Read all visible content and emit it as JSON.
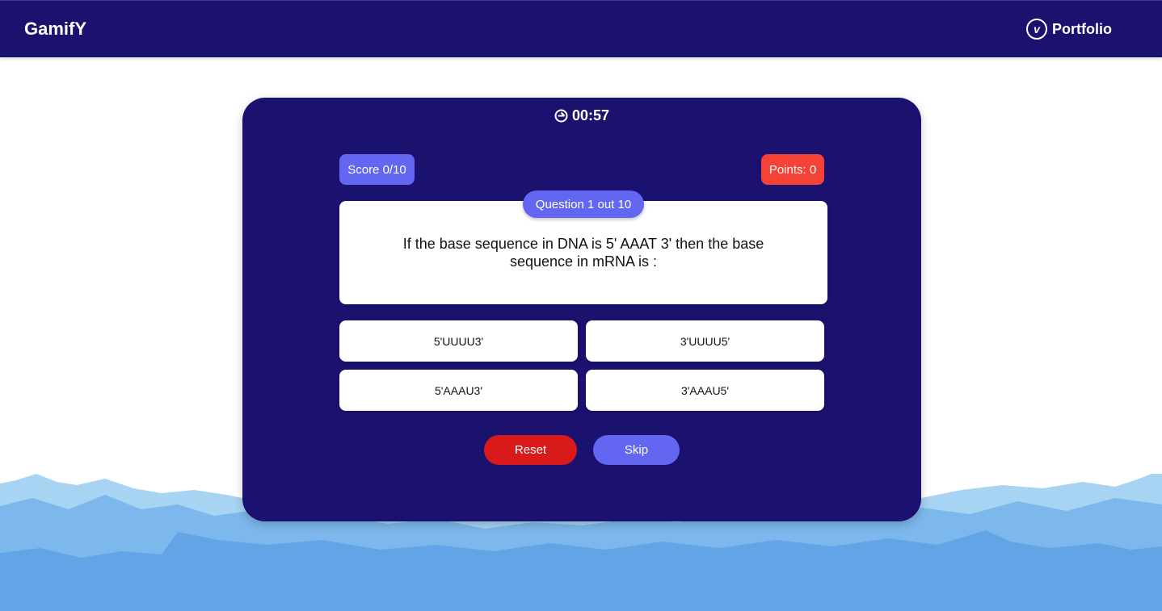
{
  "navbar": {
    "brand": "GamifY",
    "portfolio_label": "Portfolio",
    "portfolio_icon": "v-circle-icon"
  },
  "quiz": {
    "timer": "00:57",
    "timer_icon": "clock-icon",
    "score": "Score 0/10",
    "points": "Points: 0",
    "question_label": "Question 1 out 10",
    "question_text": "If the base sequence in DNA is 5' AAAT 3' then the base sequence in mRNA is :",
    "options": [
      "5'UUUU3'",
      "3'UUUU5'",
      "5'AAAU3'",
      "3'AAAU5'"
    ],
    "reset_label": "Reset",
    "skip_label": "Skip"
  },
  "colors": {
    "navy": "#1b1270",
    "accent_purple": "#6366f1",
    "points_red": "#f44336",
    "reset_red": "#d91a1a",
    "mountain_light": "#a6d4f2",
    "mountain_mid": "#7db8ec",
    "mountain_dark": "#62a4e6"
  }
}
